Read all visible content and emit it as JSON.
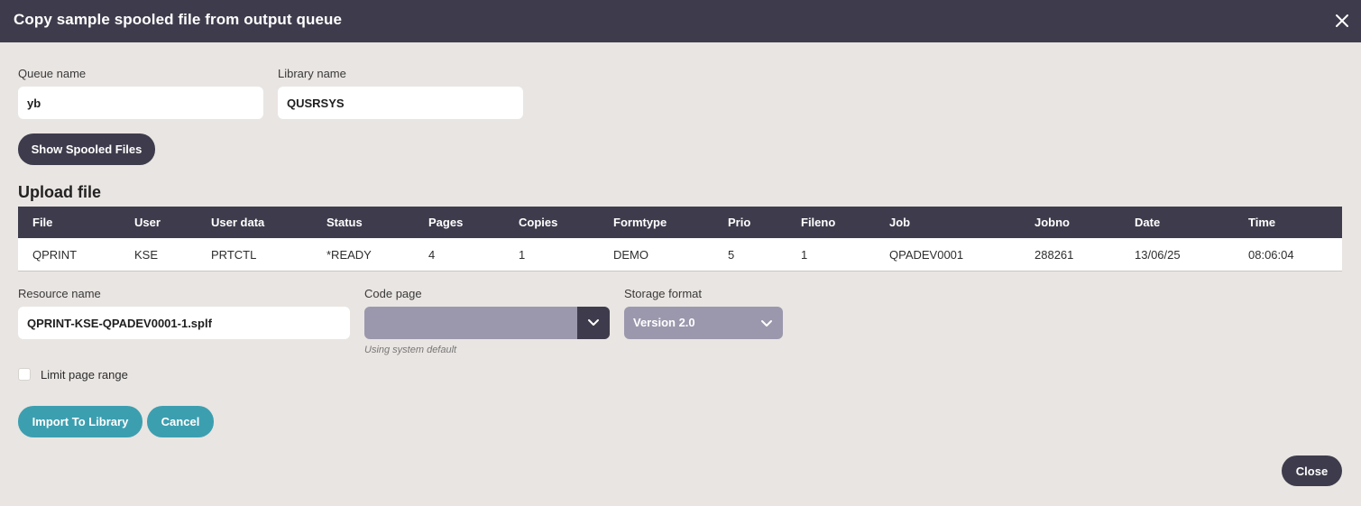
{
  "dialog": {
    "title": "Copy sample spooled file from output queue"
  },
  "form": {
    "queue_label": "Queue name",
    "queue_value": "yb",
    "library_label": "Library name",
    "library_value": "QUSRSYS",
    "show_button": "Show Spooled Files"
  },
  "upload": {
    "title": "Upload file",
    "columns": [
      "File",
      "User",
      "User data",
      "Status",
      "Pages",
      "Copies",
      "Formtype",
      "Prio",
      "Fileno",
      "Job",
      "Jobno",
      "Date",
      "Time"
    ],
    "rows": [
      [
        "QPRINT",
        "KSE",
        "PRTCTL",
        "*READY",
        "4",
        "1",
        "DEMO",
        "5",
        "1",
        "QPADEV0001",
        "288261",
        "13/06/25",
        "08:06:04"
      ]
    ]
  },
  "resource": {
    "label": "Resource name",
    "value": "QPRINT-KSE-QPADEV0001-1.splf"
  },
  "codepage": {
    "label": "Code page",
    "value": "",
    "hint": "Using system default"
  },
  "storage": {
    "label": "Storage format",
    "value": "Version 2.0"
  },
  "page_range": {
    "label": "Limit page range",
    "checked": false
  },
  "actions": {
    "import_label": "Import To Library",
    "cancel_label": "Cancel",
    "close_label": "Close"
  },
  "icons": {
    "close": "close-icon",
    "chevron": "chevron-down-icon"
  },
  "colors": {
    "header": "#3e3c4c",
    "accent": "#3c9fb0",
    "background": "#e9e5e2",
    "select": "#9b98ad"
  }
}
